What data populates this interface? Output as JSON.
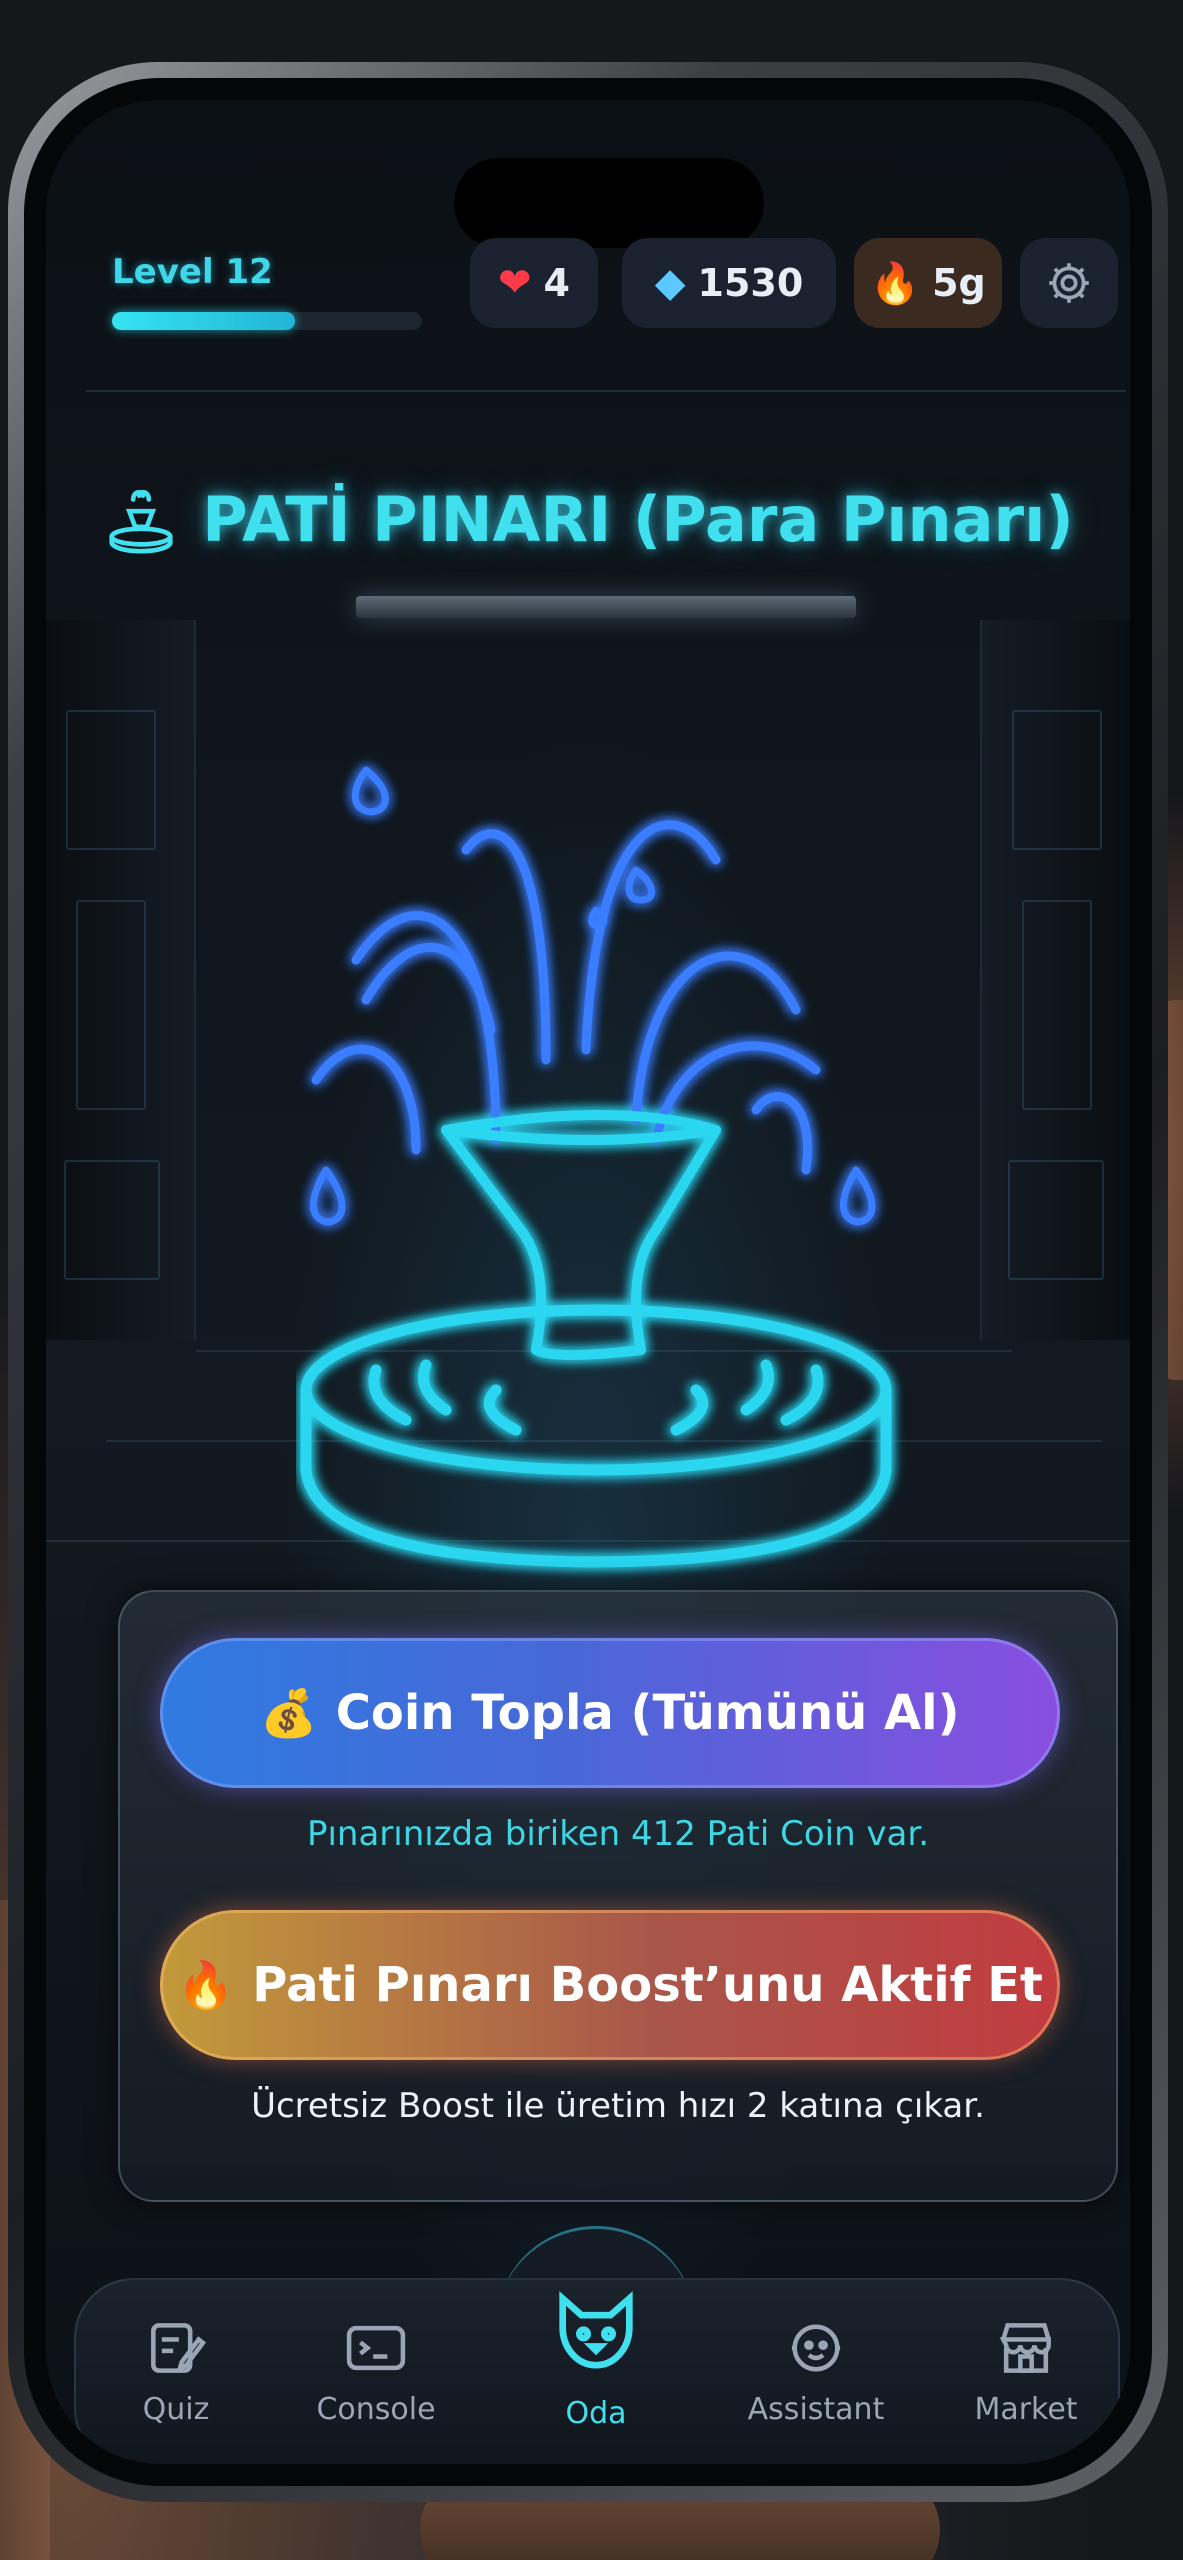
{
  "topbar": {
    "level_label": "Level 12",
    "level_progress": 0.59,
    "lives": "4",
    "gems": "1530",
    "streak": "5g"
  },
  "title": "PATİ PINARI (Para Pınarı)",
  "actions": {
    "collect_label": "Coin Topla (Tümünü Al)",
    "collect_caption": "Pınarınızda biriken 412 Pati Coin var.",
    "boost_label": "Pati Pınarı Boost’unu Aktif Et",
    "boost_caption": "Ücretsiz Boost ile üretim hızı 2 katına çıkar."
  },
  "nav": {
    "items": [
      {
        "label": "Quiz",
        "icon": "quiz-icon"
      },
      {
        "label": "Console",
        "icon": "console-icon"
      },
      {
        "label": "Oda",
        "icon": "cat-icon",
        "active": true
      },
      {
        "label": "Assistant",
        "icon": "assistant-icon"
      },
      {
        "label": "Market",
        "icon": "market-icon"
      }
    ]
  },
  "colors": {
    "accent_cyan": "#40e0ee",
    "collect_gradient": [
      "#2f7be0",
      "#8a4ee0"
    ],
    "boost_gradient": [
      "#c29a3a",
      "#c23b3f"
    ]
  }
}
